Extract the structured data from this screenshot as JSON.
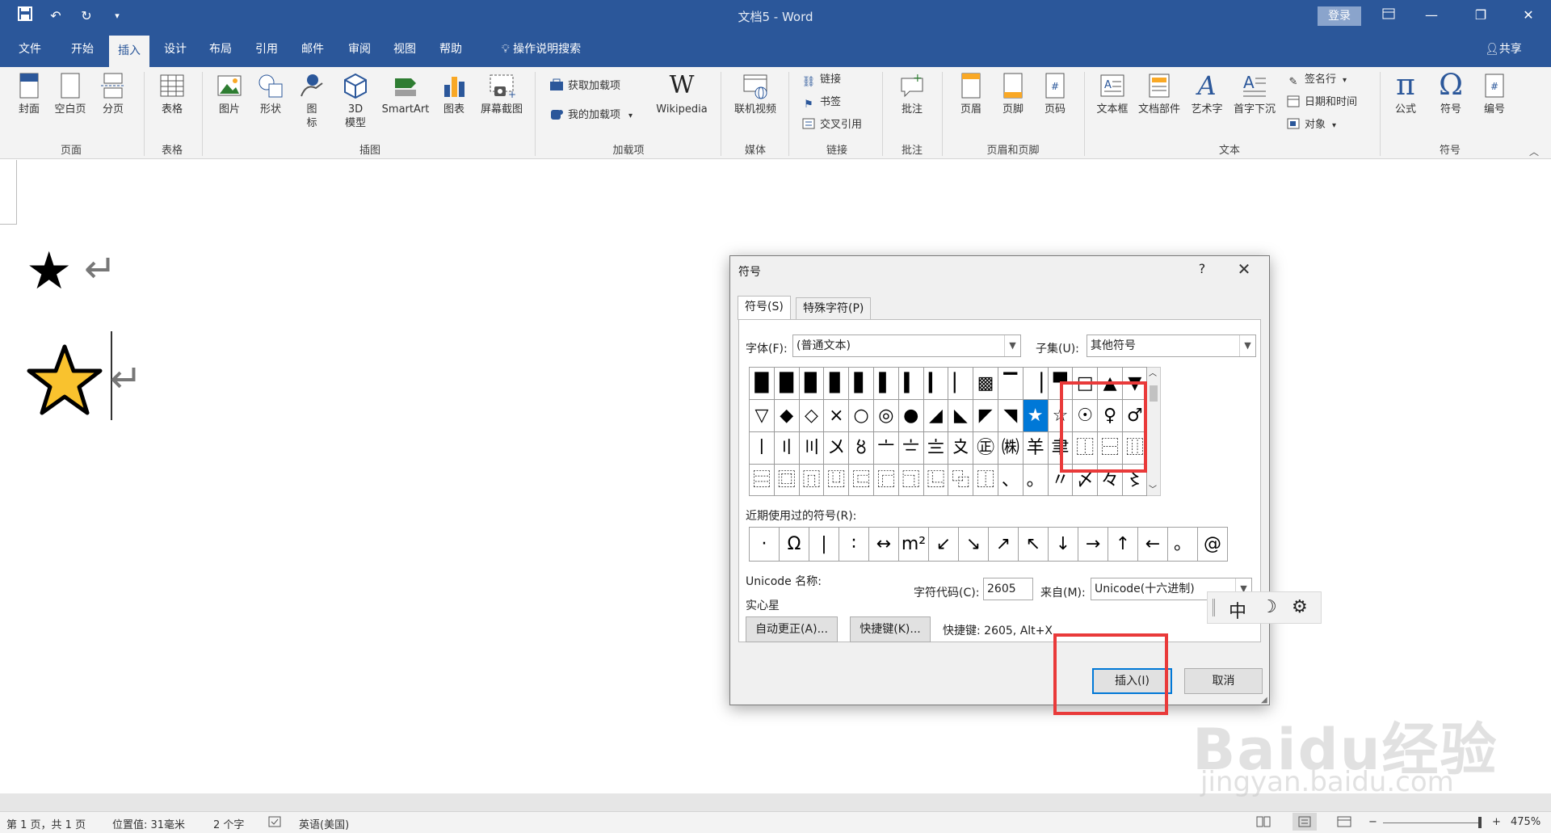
{
  "window": {
    "title": "文档5 - Word",
    "login": "登录",
    "qat": [
      "save-icon",
      "undo-icon",
      "redo-icon",
      "customize-icon"
    ]
  },
  "tabs": [
    {
      "label": "文件"
    },
    {
      "label": "开始"
    },
    {
      "label": "插入"
    },
    {
      "label": "设计"
    },
    {
      "label": "布局"
    },
    {
      "label": "引用"
    },
    {
      "label": "邮件"
    },
    {
      "label": "审阅"
    },
    {
      "label": "视图"
    },
    {
      "label": "帮助"
    },
    {
      "label": "操作说明搜索"
    }
  ],
  "active_tab": "插入",
  "share": "共享",
  "ribbon": {
    "pages": {
      "label": "页面",
      "cover": "封面",
      "blank": "空白页",
      "break": "分页"
    },
    "tables": {
      "label": "表格",
      "table": "表格"
    },
    "illustrations": {
      "label": "插图",
      "picture": "图片",
      "shapes": "形状",
      "icons": "图\n标",
      "model3d": "3D\n模型",
      "smartart": "SmartArt",
      "chart": "图表",
      "screenshot": "屏幕截图"
    },
    "addins": {
      "label": "加载项",
      "get": "获取加载项",
      "mine": "我的加载项",
      "wikipedia": "Wikipedia"
    },
    "media": {
      "label": "媒体",
      "video": "联机视频"
    },
    "links": {
      "label": "链接",
      "link": "链接",
      "bookmark": "书签",
      "crossref": "交叉引用"
    },
    "comments": {
      "label": "批注",
      "comment": "批注"
    },
    "headerfooter": {
      "label": "页眉和页脚",
      "header": "页眉",
      "footer": "页脚",
      "pagenum": "页码"
    },
    "text": {
      "label": "文本",
      "textbox": "文本框",
      "quickparts": "文档部件",
      "wordart": "艺术字",
      "dropcap": "首字下沉",
      "signature": "签名行",
      "datetime": "日期和时间",
      "object": "对象"
    },
    "symbols": {
      "label": "符号",
      "equation": "公式",
      "symbol": "符号",
      "number": "编号"
    }
  },
  "document": {
    "star_black": "★",
    "star_outline": "☆",
    "return_mark": "↵"
  },
  "dialog": {
    "title": "符号",
    "help": "?",
    "close": "✕",
    "tab_symbols": "符号(S)",
    "tab_special": "特殊字符(P)",
    "font_label": "字体(F):",
    "font_value": "(普通文本)",
    "subset_label": "子集(U):",
    "subset_value": "其他符号",
    "grid": [
      [
        "█",
        "█",
        "▉",
        "▊",
        "▋",
        "▌",
        "▍",
        "▎",
        "▏",
        "▩",
        "▔",
        "▕",
        "▀",
        "□",
        "▲",
        "▼"
      ],
      [
        "▽",
        "◆",
        "◇",
        "×",
        "○",
        "◎",
        "●",
        "◢",
        "◣",
        "◤",
        "◥",
        "★",
        "☆",
        "☉",
        "♀",
        "♂"
      ],
      [
        "〡",
        "〢",
        "〣",
        "〤",
        "〥",
        "〦",
        "〧",
        "〨",
        "〩",
        "㊣",
        "㈱",
        "羊",
        "聿",
        "⿰",
        "⿱",
        "⿲"
      ],
      [
        "⿳",
        "⿴",
        "⿵",
        "⿶",
        "⿷",
        "⿸",
        "⿹",
        "⿺",
        "⿻",
        "⿰",
        "、",
        "。",
        "〃",
        "〆",
        "々",
        "〻"
      ]
    ],
    "selected_index": "11",
    "recent_label": "近期使用过的符号(R):",
    "recent": [
      "·",
      "Ω",
      "|",
      "∶",
      "↔",
      "m²",
      "↙",
      "↘",
      "↗",
      "↖",
      "↓",
      "→",
      "↑",
      "←",
      "。",
      "@"
    ],
    "unicode_name_label": "Unicode 名称:",
    "unicode_name_value": "实心星",
    "code_label": "字符代码(C):",
    "code_value": "2605",
    "from_label": "来自(M):",
    "from_value": "Unicode(十六进制)",
    "autocorrect": "自动更正(A)...",
    "shortcut_btn": "快捷键(K)...",
    "shortcut_text": "快捷键: 2605, Alt+X",
    "insert": "插入(I)",
    "cancel": "取消"
  },
  "ime": {
    "mode": "中",
    "moon": "☽",
    "gear": "⚙"
  },
  "statusbar": {
    "page": "第 1 页，共 1 页",
    "position": "位置值: 31毫米",
    "words": "2 个字",
    "lang": "英语(美国)",
    "zoom": "475%"
  },
  "watermark": {
    "logo": "Baidu经验",
    "url": "jingyan.baidu.com"
  },
  "colors": {
    "brand": "#2b579a",
    "selected": "#0078d7",
    "annotation": "#e93a3a",
    "star_fill": "#f9c22e"
  }
}
